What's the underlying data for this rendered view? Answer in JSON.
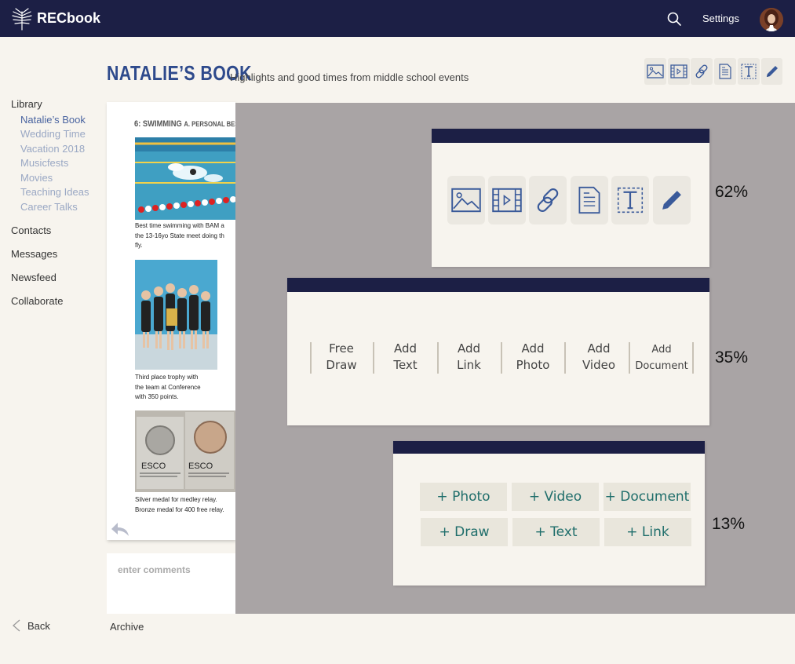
{
  "header": {
    "app_name": "RECbook",
    "settings_label": "Settings",
    "logo_icon": "palm-leaf-icon",
    "search_icon": "search-icon",
    "avatar_icon": "user-avatar"
  },
  "book": {
    "title": "NATALIE’S BOOK",
    "subtitle": "Highlights and good times from middle school events"
  },
  "toolbar": {
    "tools": [
      "image-icon",
      "video-icon",
      "link-icon",
      "document-icon",
      "text-icon",
      "pencil-icon"
    ]
  },
  "sidebar": {
    "library_label": "Library",
    "library_items": [
      {
        "label": "Natalie’s Book",
        "active": true
      },
      {
        "label": "Wedding Time",
        "active": false
      },
      {
        "label": "Vacation 2018",
        "active": false
      },
      {
        "label": "Musicfests",
        "active": false
      },
      {
        "label": "Movies",
        "active": false
      },
      {
        "label": "Teaching Ideas",
        "active": false
      },
      {
        "label": "Career Talks",
        "active": false
      }
    ],
    "sections": [
      "Contacts",
      "Messages",
      "Newsfeed",
      "Collaborate"
    ]
  },
  "page": {
    "heading": "6: SWIMMING",
    "heading_sub": "A. PERSONAL BES",
    "entries": [
      {
        "caption_lines": [
          "Best time swimming with BAM a",
          "the 13-16yo State meet doing th",
          "fly."
        ]
      },
      {
        "caption_lines": [
          "Third place trophy with",
          "the team at Conference",
          "with 350 points."
        ]
      },
      {
        "caption_lines": [
          "Silver medal for medley relay.",
          "Bronze medal for 400 free relay."
        ]
      }
    ],
    "medal_text_left": "ESCO",
    "medal_text_right": "ESCO"
  },
  "comments": {
    "placeholder": "enter comments"
  },
  "options": {
    "icon_variant": {
      "percent": "62%",
      "icons": [
        "image-icon",
        "video-icon",
        "link-icon",
        "document-icon",
        "text-icon",
        "pencil-icon"
      ]
    },
    "text_variant": {
      "percent": "35%",
      "items": [
        {
          "line1": "Free",
          "line2": "Draw"
        },
        {
          "line1": "Add",
          "line2": "Text"
        },
        {
          "line1": "Add",
          "line2": "Link"
        },
        {
          "line1": "Add",
          "line2": "Photo"
        },
        {
          "line1": "Add",
          "line2": "Video"
        },
        {
          "line1": "Add",
          "line2": "Document"
        }
      ]
    },
    "plus_variant": {
      "percent": "13%",
      "items": [
        "+ Photo",
        "+ Video",
        "+ Document",
        "+ Draw",
        "+ Text",
        "+ Link"
      ]
    }
  },
  "footer": {
    "back_label": "Back",
    "archive_label": "Archive"
  },
  "colors": {
    "nav_bg": "#1c1f45",
    "title_blue": "#2e4a8c",
    "accent_teal": "#1f6e6b",
    "overlay_gray": "#a9a4a5",
    "page_bg": "#f7f4ee"
  }
}
